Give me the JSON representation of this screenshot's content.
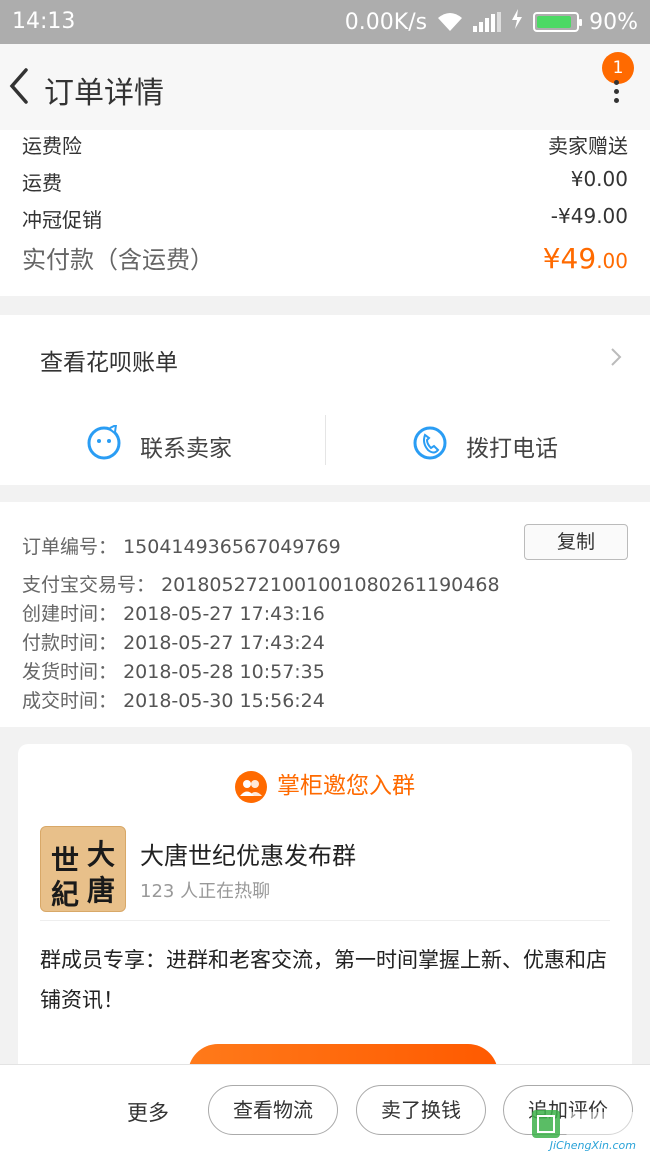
{
  "status_bar": {
    "time": "14:13",
    "net_speed": "0.00K/s",
    "battery": "90%",
    "battery_level": 0.9
  },
  "nav": {
    "title": "订单详情",
    "badge_count": "1"
  },
  "fees": {
    "insurance_label": "运费险",
    "insurance_value": "卖家赠送",
    "shipping_label": "运费",
    "shipping_value": "¥0.00",
    "promo_label": "冲冠促销",
    "promo_value": "-¥49.00",
    "total_label": "实付款（含运费）",
    "total_value_main": "¥49",
    "total_value_decimal": ".00"
  },
  "actions": {
    "huabei_label": "查看花呗账单",
    "contact_seller_label": "联系卖家",
    "call_label": "拨打电话"
  },
  "order_info": {
    "copy_label": "复制",
    "rows": [
      {
        "key": "订单编号：",
        "value": "150414936567049769"
      },
      {
        "key": "支付宝交易号：",
        "value": "2018052721001001080261190468"
      },
      {
        "key": "创建时间：",
        "value": "2018-05-27 17:43:16"
      },
      {
        "key": "付款时间：",
        "value": "2018-05-27 17:43:24"
      },
      {
        "key": "发货时间：",
        "value": "2018-05-28 10:57:35"
      },
      {
        "key": "成交时间：",
        "value": "2018-05-30 15:56:24"
      }
    ]
  },
  "group": {
    "header": "掌柜邀您入群",
    "avatar_chars": [
      "大",
      "世",
      "唐",
      "紀"
    ],
    "name": "大唐世纪优惠发布群",
    "count_text": "123 人正在热聊",
    "desc": "群成员专享：进群和老客交流，第一时间掌握上新、优惠和店铺资讯！"
  },
  "bottom_bar": {
    "more_label": "更多",
    "logistics_label": "查看物流",
    "resell_label": "卖了换钱",
    "review_label": "追加评价"
  },
  "watermark": {
    "site": "JiChengXin.com"
  },
  "colors": {
    "accent": "#ff6a00",
    "icon_blue": "#2a9df4",
    "status_bar": "#adadad"
  }
}
